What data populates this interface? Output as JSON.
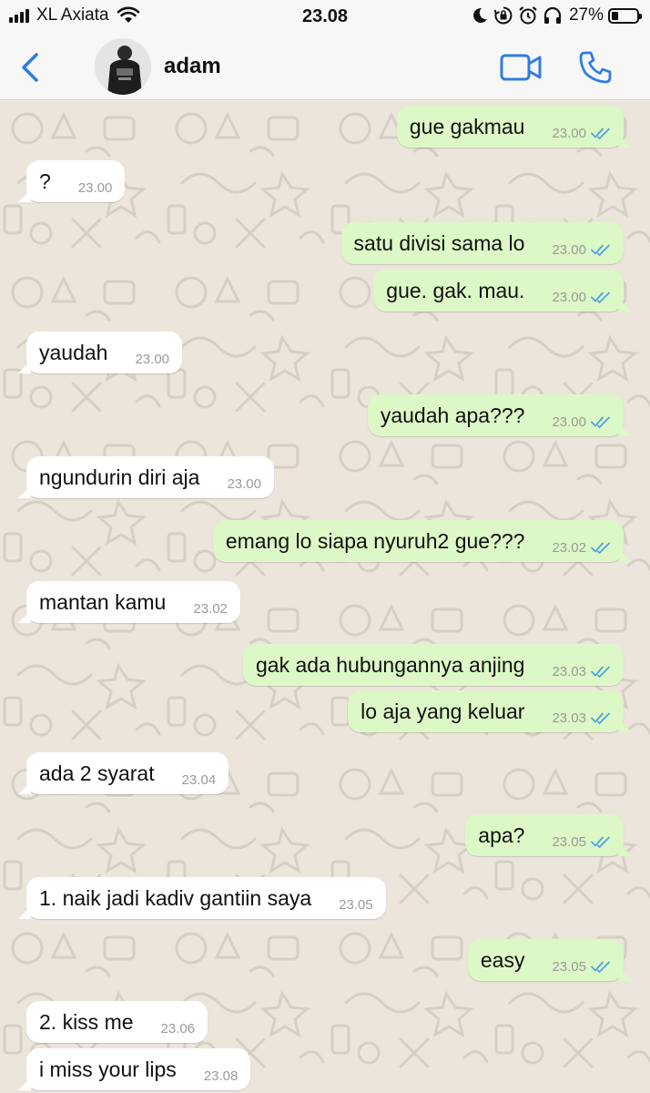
{
  "status_bar": {
    "carrier": "XL Axiata",
    "time": "23.08",
    "battery_percent": "27%",
    "battery_level": 0.27,
    "icons": [
      "signal-icon",
      "wifi-icon",
      "moon-icon",
      "rotation-lock-icon",
      "alarm-icon",
      "headphones-icon",
      "battery-icon"
    ]
  },
  "header": {
    "back_icon": "chevron-left-icon",
    "contact_name": "adam",
    "video_icon": "video-camera-icon",
    "call_icon": "phone-icon"
  },
  "colors": {
    "accent": "#2f7de1",
    "outgoing_bubble": "#dcf8c6",
    "incoming_bubble": "#ffffff",
    "read_ticks": "#4fa3e0",
    "wallpaper": "#ece5dc"
  },
  "messages": [
    {
      "direction": "out",
      "text": "gue gakmau",
      "time": "23.00",
      "read": true
    },
    {
      "direction": "in",
      "text": "?",
      "time": "23.00"
    },
    {
      "direction": "out",
      "text": "satu divisi sama lo",
      "time": "23.00",
      "read": true
    },
    {
      "direction": "out",
      "text": "gue. gak. mau.",
      "time": "23.00",
      "read": true
    },
    {
      "direction": "in",
      "text": "yaudah",
      "time": "23.00"
    },
    {
      "direction": "out",
      "text": "yaudah apa???",
      "time": "23.00",
      "read": true
    },
    {
      "direction": "in",
      "text": "ngundurin diri aja",
      "time": "23.00"
    },
    {
      "direction": "out",
      "text": "emang lo siapa nyuruh2 gue???",
      "time": "23.02",
      "read": true
    },
    {
      "direction": "in",
      "text": "mantan kamu",
      "time": "23.02"
    },
    {
      "direction": "out",
      "text": "gak ada hubungannya anjing",
      "time": "23.03",
      "read": true
    },
    {
      "direction": "out",
      "text": "lo aja yang keluar",
      "time": "23.03",
      "read": true
    },
    {
      "direction": "in",
      "text": "ada 2 syarat",
      "time": "23.04"
    },
    {
      "direction": "out",
      "text": "apa?",
      "time": "23.05",
      "read": true
    },
    {
      "direction": "in",
      "text": "1. naik jadi kadiv gantiin saya",
      "time": "23.05"
    },
    {
      "direction": "out",
      "text": "easy",
      "time": "23.05",
      "read": true
    },
    {
      "direction": "in",
      "text": "2. kiss me",
      "time": "23.06"
    },
    {
      "direction": "in",
      "text": "i miss your lips",
      "time": "23.08"
    }
  ]
}
